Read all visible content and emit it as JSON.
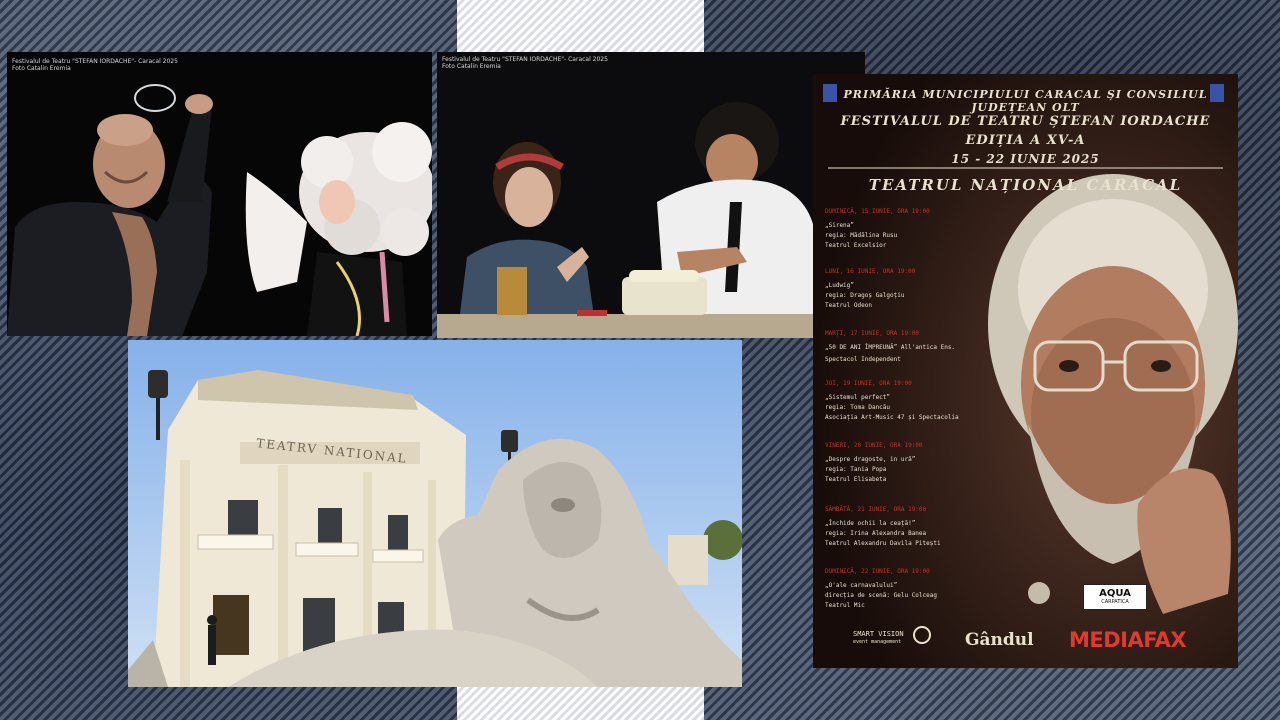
{
  "photo_actors_1": {
    "caption_line1": "Festivalul de Teatru \"STEFAN IORDACHE\"- Caracal 2025",
    "caption_line2": "Foto Catalin Eremia"
  },
  "photo_actors_2": {
    "caption_line1": "Festivalul de Teatru  \"STEFAN IORDACHE\"- Caracal 2025",
    "caption_line2": "Foto Catalin Eremia"
  },
  "photo_theatre": {
    "facade_sign": "TEATRV NATIONAL"
  },
  "poster": {
    "header": "PRIMĂRIA MUNICIPIULUI CARACAL ȘI CONSILIUL JUDEȚEAN OLT",
    "festival_name": "FESTIVALUL DE TEATRU ȘTEFAN IORDACHE",
    "edition": "EDIȚIA A XV-A",
    "dates": "15 - 22 IUNIE 2025",
    "venue": "TEATRUL NAȚIONAL CARACAL",
    "events": [
      {
        "day": "DUMINICĂ, 15 IUNIE, ORA 19:00",
        "title": "„Sirena”",
        "credit": "regia: Mădălina Rusu",
        "company": "Teatrul Excelsior"
      },
      {
        "day": "LUNI, 16 IUNIE, ORA 19:00",
        "title": "„Ludwig”",
        "credit": "regia: Dragoș Galgoțiu",
        "company": "Teatrul Odeon"
      },
      {
        "day": "MARȚI, 17 IUNIE, ORA 19:00",
        "title": "„50 DE ANI ÎMPREUNĂ” All'antica Ens.",
        "credit": "Spectacol Independent",
        "company": ""
      },
      {
        "day": "JOI, 19 IUNIE, ORA 19:00",
        "title": "„Sistemul perfect”",
        "credit": "regia: Toma Dancău",
        "company": "Asociația Art-Music 47 și Spectacolia"
      },
      {
        "day": "VINERI, 20 IUNIE, ORA 19:00",
        "title": "„Despre dragoste, in ură”",
        "credit": "regia: Tania Popa",
        "company": "Teatrul Elisabeta"
      },
      {
        "day": "SÂMBĂTĂ, 21 IUNIE, ORA 19:00",
        "title": "„Închide ochii la ceață!”",
        "credit": "regia: Irina Alexandra Banea",
        "company": "Teatrul Alexandru Davila Pitești"
      },
      {
        "day": "DUMINICĂ, 22 IUNIE, ORA 19:00",
        "title": "„O'ale carnavalului”",
        "credit": "direcția de scenă: Gelu Colceag",
        "company": "Teatrul Mic"
      }
    ],
    "sponsors": {
      "smart_vision": "SMART VISION",
      "smart_vision_sub": "event management",
      "aqua": "AQUA",
      "aqua_sub": "CARPATICA",
      "gandul": "Gândul",
      "mediafax": "MEDIAFAX"
    }
  },
  "colors": {
    "poster_text": "#e9e2cf",
    "poster_red": "#c8302a",
    "mediafax_red": "#e03a2f"
  }
}
